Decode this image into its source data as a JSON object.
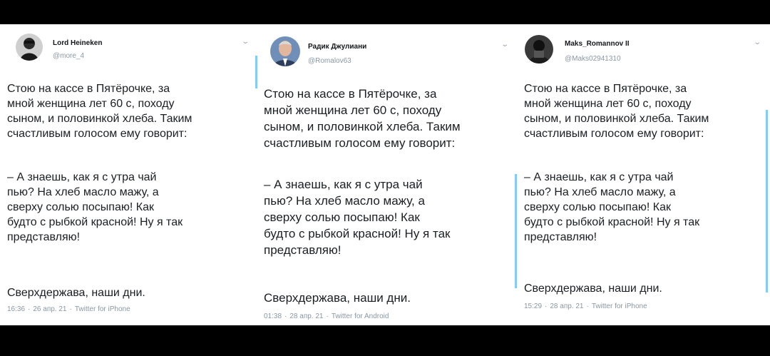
{
  "tweets": [
    {
      "name": "Lord Heineken",
      "handle": "@more_4",
      "paragraphs": [
        "Стою на кассе в Пятёрочке, за\nмной женщина лет 60 с, походу\nсыном, и половинкой хлеба. Таким\nсчастливым голосом ему говорит:",
        "– А знаешь, как я с утра чай\nпью? На хлеб масло мажу, а\nсверху солью посыпаю! Как\nбудто с рыбкой красной! Ну я так\nпредставляю!",
        "Сверхдержава, наши дни."
      ],
      "time": "16:36",
      "date": "26 апр. 21",
      "source": "Twitter for iPhone"
    },
    {
      "name": "Радик Джулиани",
      "handle": "@Romalov63",
      "paragraphs": [
        "Стою на кассе в Пятёрочке, за\nмной женщина лет 60 с, походу\nсыном, и половинкой хлеба. Таким\nсчастливым голосом ему говорит:",
        "– А знаешь, как я с утра чай\nпью? На хлеб масло мажу, а\nсверху солью посыпаю! Как\nбудто с рыбкой красной! Ну я так\nпредставляю!",
        "Сверхдержава, наши дни."
      ],
      "time": "01:38",
      "date": "28 апр. 21",
      "source": "Twitter for Android"
    },
    {
      "name": "Maks_Romannov II",
      "handle": "@Maks02941310",
      "paragraphs": [
        "Стою на кассе в Пятёрочке, за\nмной женщина лет 60 с, походу\nсыном, и половинкой хлеба. Таким\nсчастливым голосом ему говорит:",
        "– А знаешь, как я с утра чай\nпью? На хлеб масло мажу, а\nсверху солью посыпаю! Как\nбудто с рыбкой красной! Ну я так\nпредставляю!",
        "Сверхдержава, наши дни."
      ],
      "time": "15:29",
      "date": "28 апр. 21",
      "source": "Twitter for iPhone"
    }
  ],
  "icons": {
    "menu": "chevron-down-icon",
    "separator": "·"
  },
  "colors": {
    "link": "#1da1f2",
    "muted": "#8a97a3",
    "text": "#1b1f23"
  }
}
